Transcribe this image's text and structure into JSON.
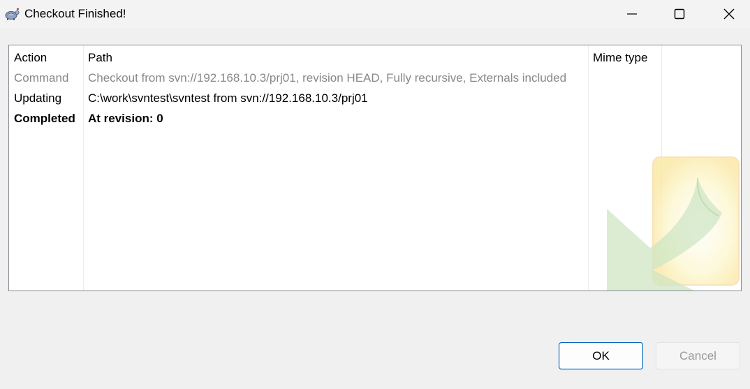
{
  "window": {
    "title": "Checkout Finished!",
    "controls": {
      "minimize": "minimize-icon",
      "maximize": "maximize-icon",
      "close": "close-icon"
    }
  },
  "log": {
    "columns": {
      "action": "Action",
      "path": "Path",
      "mime_type": "Mime type"
    },
    "rows": [
      {
        "action": "Command",
        "path": "Checkout from svn://192.168.10.3/prj01, revision HEAD, Fully recursive, Externals included",
        "mime_type": "",
        "style": "gray"
      },
      {
        "action": "Updating",
        "path": "C:\\work\\svntest\\svntest from svn://192.168.10.3/prj01",
        "mime_type": "",
        "style": "normal"
      },
      {
        "action": "Completed",
        "path": "At revision: 0",
        "mime_type": "",
        "style": "bold"
      }
    ]
  },
  "buttons": {
    "ok": "OK",
    "cancel": "Cancel"
  },
  "colors": {
    "accent": "#005fb8",
    "gray_text": "#888888",
    "disabled_text": "#9a9a9a"
  }
}
